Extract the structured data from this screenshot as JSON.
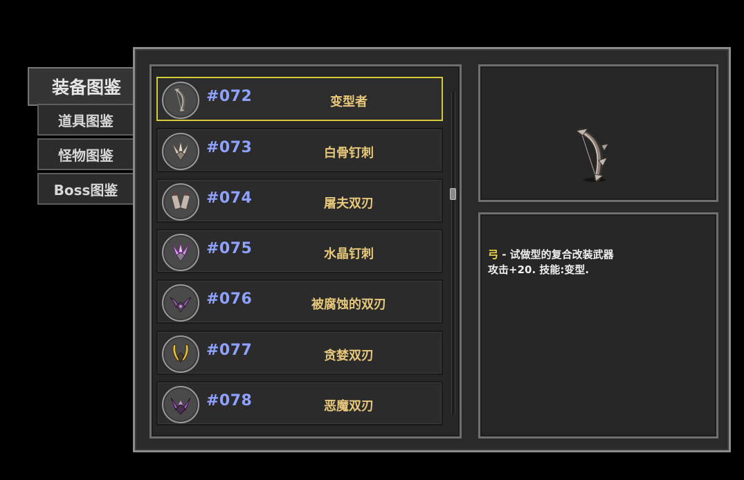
{
  "tabs": [
    {
      "label": "装备图鉴",
      "active": true
    },
    {
      "label": "道具图鉴",
      "active": false
    },
    {
      "label": "怪物图鉴",
      "active": false
    },
    {
      "label": "Boss图鉴",
      "active": false
    }
  ],
  "list": {
    "selected_index": 0,
    "scroll_position": 0.3,
    "items": [
      {
        "number": "#072",
        "name": "变型者",
        "icon": "bow-icon",
        "color": "#b8b0a8"
      },
      {
        "number": "#073",
        "name": "白骨钉刺",
        "icon": "bone-spike-icon",
        "color": "#d8d0c4"
      },
      {
        "number": "#074",
        "name": "屠夫双刃",
        "icon": "cleaver-icon",
        "color": "#c4b8ae"
      },
      {
        "number": "#075",
        "name": "水晶钉刺",
        "icon": "crystal-spike-icon",
        "color": "#d890e8"
      },
      {
        "number": "#076",
        "name": "被腐蚀的双刃",
        "icon": "corroded-blades-icon",
        "color": "#a070b8"
      },
      {
        "number": "#077",
        "name": "贪婪双刃",
        "icon": "golden-blades-icon",
        "color": "#e6c23a"
      },
      {
        "number": "#078",
        "name": "恶魔双刃",
        "icon": "demon-blades-icon",
        "color": "#b070c8"
      }
    ]
  },
  "preview": {
    "icon": "bow-icon"
  },
  "description": {
    "type_label": "弓",
    "line1": " - 试做型的复合改装武器",
    "line2": "攻击+20. 技能:变型."
  },
  "colors": {
    "number": "#8fa2ff",
    "name": "#e8c87a",
    "selected_border": "#d6cb3a",
    "type_label": "#f2d94b"
  }
}
